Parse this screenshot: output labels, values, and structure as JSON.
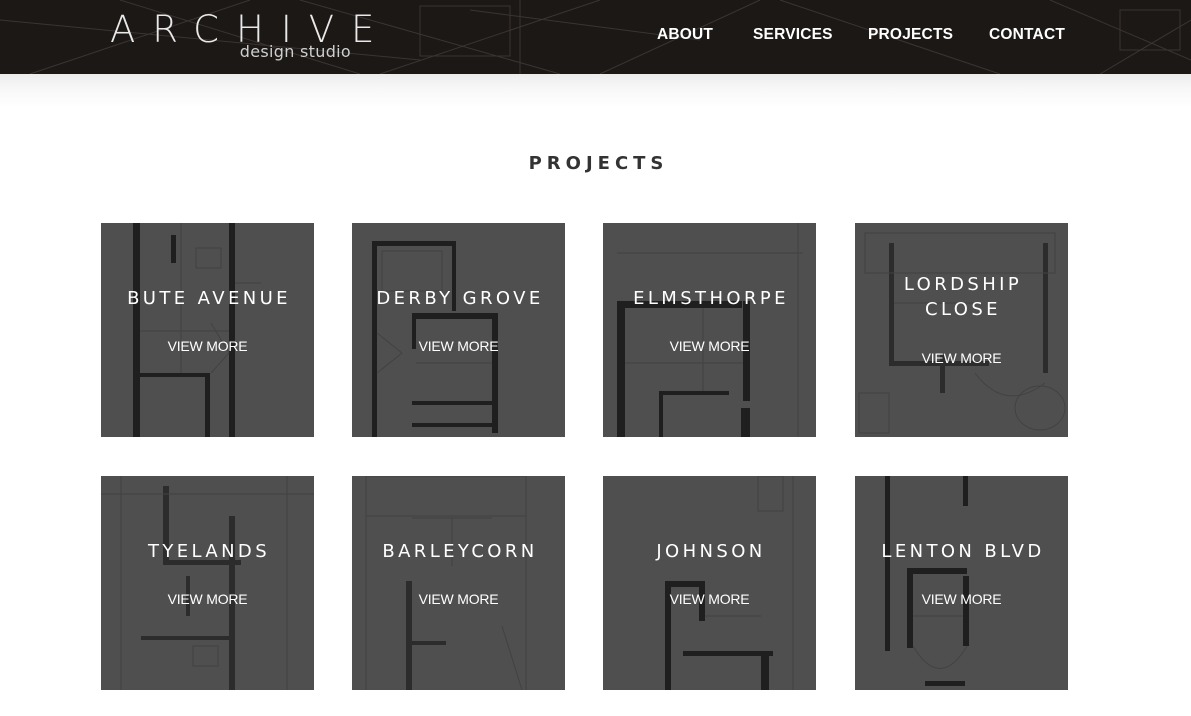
{
  "brand": {
    "name": "ARCHIVE",
    "tagline": "design studio"
  },
  "nav": {
    "items": [
      {
        "label": "ABOUT"
      },
      {
        "label": "SERVICES"
      },
      {
        "label": "PROJECTS"
      },
      {
        "label": "CONTACT"
      }
    ]
  },
  "page": {
    "title": "PROJECTS"
  },
  "projects": [
    {
      "name_line1": "BUTE AVENUE",
      "name_line2": "",
      "cta": "VIEW MORE"
    },
    {
      "name_line1": "DERBY GROVE",
      "name_line2": "",
      "cta": "VIEW MORE"
    },
    {
      "name_line1": "ELMSTHORPE",
      "name_line2": "",
      "cta": "VIEW MORE"
    },
    {
      "name_line1": "LORDSHIP",
      "name_line2": "CLOSE",
      "cta": "VIEW MORE"
    },
    {
      "name_line1": "TYELANDS",
      "name_line2": "",
      "cta": "VIEW MORE"
    },
    {
      "name_line1": "BARLEYCORN",
      "name_line2": "",
      "cta": "VIEW MORE"
    },
    {
      "name_line1": "JOHNSON",
      "name_line2": "",
      "cta": "VIEW MORE"
    },
    {
      "name_line1": "LENTON BLVD",
      "name_line2": "",
      "cta": "VIEW MORE"
    }
  ],
  "colors": {
    "header_bg": "#1c1816",
    "tile_bg": "#4f4f4f",
    "text_light": "#ffffff",
    "title_text": "#333333"
  },
  "icons": {
    "tile_background": "floor-plan-drawing"
  }
}
